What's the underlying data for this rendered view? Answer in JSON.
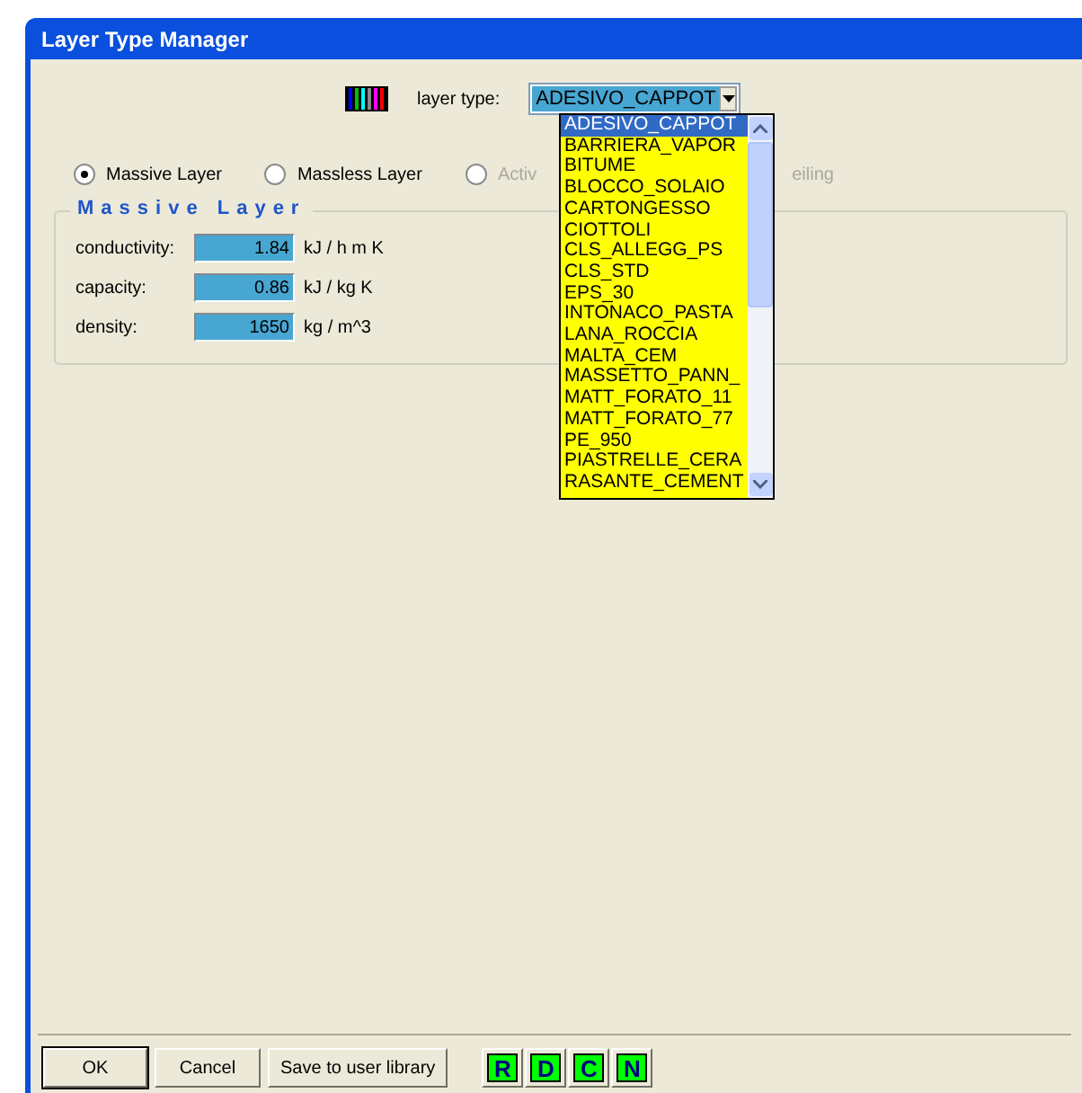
{
  "window": {
    "title": "Layer Type Manager"
  },
  "layer_type": {
    "label": "layer type:",
    "value": "ADESIVO_CAPPOT",
    "expanded": true
  },
  "dropdown_items": [
    {
      "label": "ADESIVO_CAPPOT",
      "selected": true
    },
    {
      "label": "BARRIERA_VAPOR",
      "selected": false
    },
    {
      "label": "BITUME",
      "selected": false
    },
    {
      "label": "BLOCCO_SOLAIO",
      "selected": false
    },
    {
      "label": "CARTONGESSO",
      "selected": false
    },
    {
      "label": "CIOTTOLI",
      "selected": false
    },
    {
      "label": "CLS_ALLEGG_PS",
      "selected": false
    },
    {
      "label": "CLS_STD",
      "selected": false
    },
    {
      "label": "EPS_30",
      "selected": false
    },
    {
      "label": "INTONACO_PASTA",
      "selected": false
    },
    {
      "label": "LANA_ROCCIA",
      "selected": false
    },
    {
      "label": "MALTA_CEM",
      "selected": false
    },
    {
      "label": "MASSETTO_PANN_",
      "selected": false
    },
    {
      "label": "MATT_FORATO_11",
      "selected": false
    },
    {
      "label": "MATT_FORATO_77",
      "selected": false
    },
    {
      "label": "PE_950",
      "selected": false
    },
    {
      "label": "PIASTRELLE_CERA",
      "selected": false
    },
    {
      "label": "RASANTE_CEMENT",
      "selected": false
    }
  ],
  "layer_kinds": [
    {
      "label": "Massive Layer",
      "selected": true,
      "disabled": false
    },
    {
      "label": "Massless Layer",
      "selected": false,
      "disabled": false
    },
    {
      "label": "Activ",
      "selected": false,
      "disabled": true
    }
  ],
  "hidden_option_tail": "eiling",
  "group": {
    "title": "Massive Layer",
    "fields": [
      {
        "label": "conductivity:",
        "value": "1.84",
        "unit": "kJ / h m K"
      },
      {
        "label": "capacity:",
        "value": "0.86",
        "unit": "kJ / kg K"
      },
      {
        "label": "density:",
        "value": "1650",
        "unit": "kg / m^3"
      }
    ]
  },
  "buttons": [
    {
      "label": "OK",
      "default": true
    },
    {
      "label": "Cancel",
      "default": false
    },
    {
      "label": "Save to user library",
      "default": false
    }
  ],
  "tool_buttons": [
    "R",
    "D",
    "C",
    "N"
  ]
}
